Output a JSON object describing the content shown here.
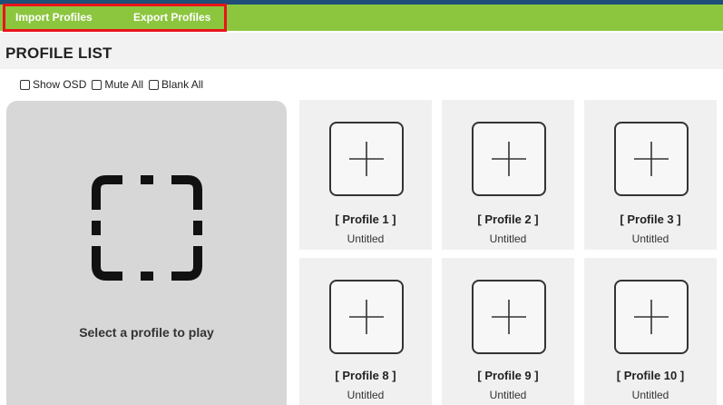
{
  "menu": {
    "import_label": "Import Profiles",
    "export_label": "Export Profiles",
    "bar_color": "#8cc63f",
    "highlight_color": "#e8141b"
  },
  "page_title": "PROFILE LIST",
  "toggles": {
    "show_osd": {
      "label": "Show OSD",
      "checked": false
    },
    "mute_all": {
      "label": "Mute All",
      "checked": false
    },
    "blank_all": {
      "label": "Blank All",
      "checked": false
    }
  },
  "player": {
    "icon": "dashed-select-icon",
    "label": "Select a profile to play"
  },
  "profiles": [
    {
      "name": "[ Profile 1 ]",
      "subtitle": "Untitled",
      "icon": "plus-icon"
    },
    {
      "name": "[ Profile 2 ]",
      "subtitle": "Untitled",
      "icon": "plus-icon"
    },
    {
      "name": "[ Profile 3 ]",
      "subtitle": "Untitled",
      "icon": "plus-icon"
    },
    {
      "name": "[ Profile 8 ]",
      "subtitle": "Untitled",
      "icon": "plus-icon"
    },
    {
      "name": "[ Profile 9 ]",
      "subtitle": "Untitled",
      "icon": "plus-icon"
    },
    {
      "name": "[ Profile 10 ]",
      "subtitle": "Untitled",
      "icon": "plus-icon"
    }
  ]
}
